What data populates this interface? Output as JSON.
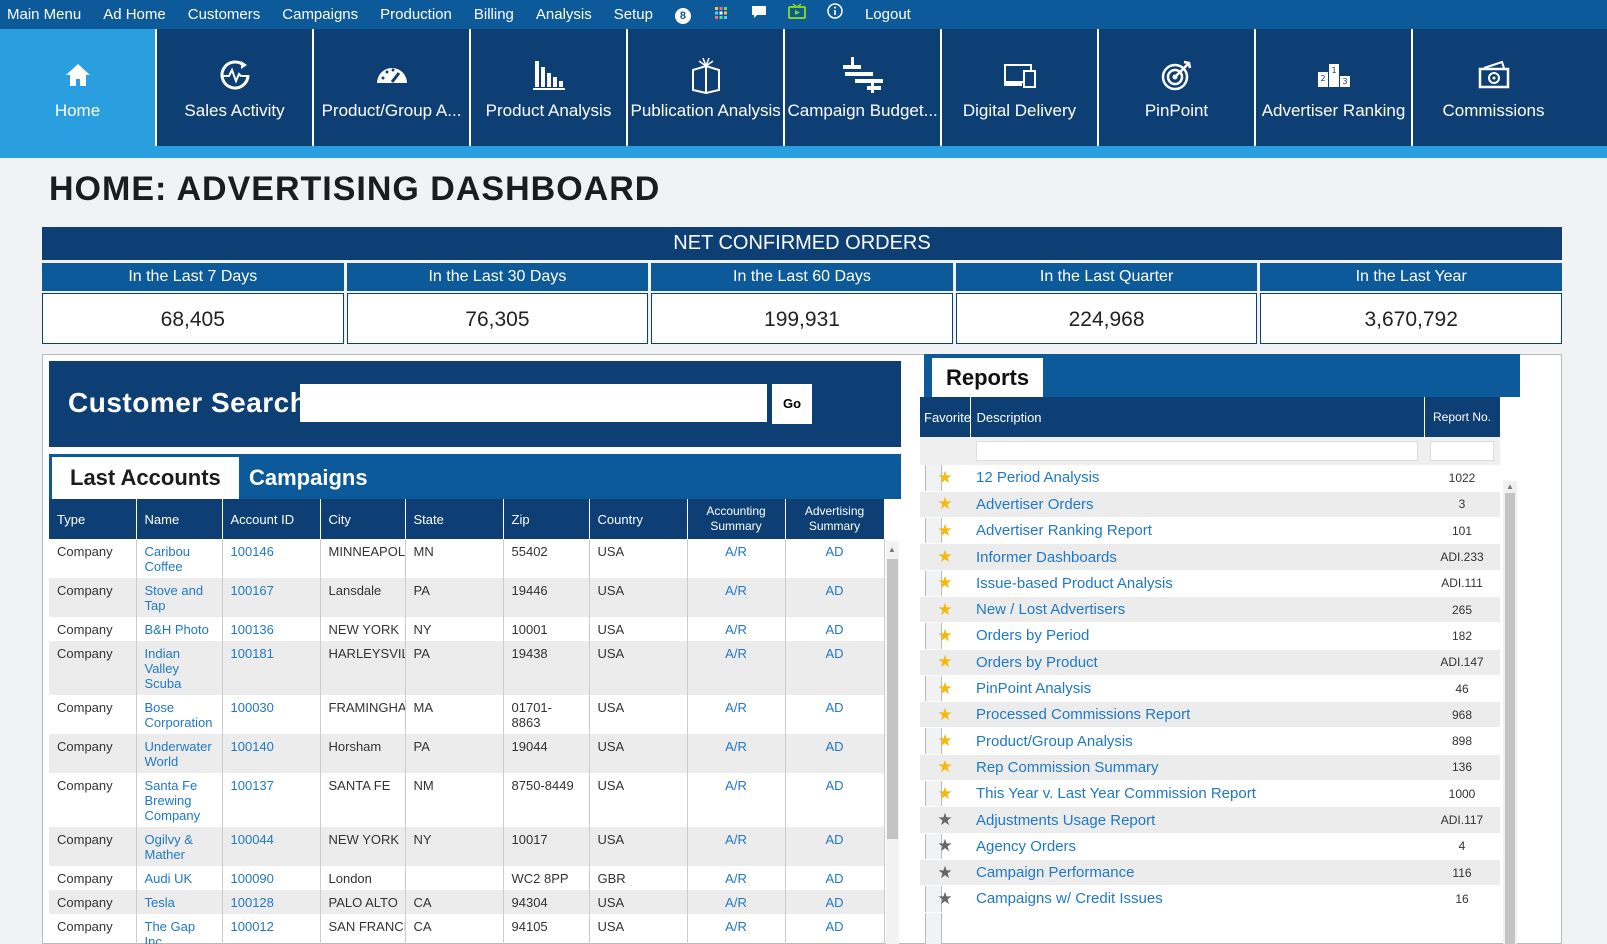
{
  "topmenu": {
    "items": [
      "Main Menu",
      "Ad Home",
      "Customers",
      "Campaigns",
      "Production",
      "Billing",
      "Analysis",
      "Setup"
    ],
    "badge": "8",
    "logout": "Logout"
  },
  "tiles": [
    {
      "label": "Home",
      "icon": "home-icon"
    },
    {
      "label": "Sales Activity",
      "icon": "sales-activity-icon"
    },
    {
      "label": "Product/Group A...",
      "icon": "gauge-icon"
    },
    {
      "label": "Product Analysis",
      "icon": "bar-chart-icon"
    },
    {
      "label": "Publication Analysis",
      "icon": "publication-icon"
    },
    {
      "label": "Campaign Budget...",
      "icon": "campaign-budget-icon"
    },
    {
      "label": "Digital Delivery",
      "icon": "devices-icon"
    },
    {
      "label": "PinPoint",
      "icon": "target-icon"
    },
    {
      "label": "Advertiser Ranking",
      "icon": "podium-icon"
    },
    {
      "label": "Commissions",
      "icon": "money-icon"
    }
  ],
  "page_title": "HOME: ADVERTISING DASHBOARD",
  "orders": {
    "title": "NET CONFIRMED ORDERS",
    "periods": [
      {
        "label": "In the Last 7 Days",
        "value": "68,405"
      },
      {
        "label": "In the Last 30 Days",
        "value": "76,305"
      },
      {
        "label": "In the Last 60 Days",
        "value": "199,931"
      },
      {
        "label": "In the Last Quarter",
        "value": "224,968"
      },
      {
        "label": "In the Last Year",
        "value": "3,670,792"
      }
    ]
  },
  "customer_search": {
    "label": "Customer Search",
    "value": "",
    "go": "Go"
  },
  "left_tabs": {
    "active": "Last Accounts",
    "other": "Campaigns"
  },
  "accounts": {
    "columns": [
      "Type",
      "Name",
      "Account ID",
      "City",
      "State",
      "Zip",
      "Country",
      "Accounting Summary",
      "Advertising Summary"
    ],
    "rows": [
      [
        "Company",
        "Caribou Coffee",
        "100146",
        "MINNEAPOLIS",
        "MN",
        "55402",
        "USA",
        "A/R",
        "AD"
      ],
      [
        "Company",
        "Stove and Tap",
        "100167",
        "Lansdale",
        "PA",
        "19446",
        "USA",
        "A/R",
        "AD"
      ],
      [
        "Company",
        "B&H Photo",
        "100136",
        "NEW YORK",
        "NY",
        "10001",
        "USA",
        "A/R",
        "AD"
      ],
      [
        "Company",
        "Indian Valley Scuba",
        "100181",
        "HARLEYSVILLE",
        "PA",
        "19438",
        "USA",
        "A/R",
        "AD"
      ],
      [
        "Company",
        "Bose Corporation",
        "100030",
        "FRAMINGHAM",
        "MA",
        "01701-8863",
        "USA",
        "A/R",
        "AD"
      ],
      [
        "Company",
        "Underwater World",
        "100140",
        "Horsham",
        "PA",
        "19044",
        "USA",
        "A/R",
        "AD"
      ],
      [
        "Company",
        "Santa Fe Brewing Company",
        "100137",
        "SANTA FE",
        "NM",
        "8750-8449",
        "USA",
        "A/R",
        "AD"
      ],
      [
        "Company",
        "Ogilvy & Mather",
        "100044",
        "NEW YORK",
        "NY",
        "10017",
        "USA",
        "A/R",
        "AD"
      ],
      [
        "Company",
        "Audi UK",
        "100090",
        "London",
        "",
        "WC2 8PP",
        "GBR",
        "A/R",
        "AD"
      ],
      [
        "Company",
        "Tesla",
        "100128",
        "PALO ALTO",
        "CA",
        "94304",
        "USA",
        "A/R",
        "AD"
      ],
      [
        "Company",
        "The Gap Inc.",
        "100012",
        "SAN FRANCISCO",
        "CA",
        "94105",
        "USA",
        "A/R",
        "AD"
      ]
    ]
  },
  "reports": {
    "tab": "Reports",
    "columns": [
      "Favorite",
      "Description",
      "Report No."
    ],
    "rows": [
      {
        "fav": true,
        "desc": "12 Period Analysis",
        "no": "1022"
      },
      {
        "fav": true,
        "desc": "Advertiser Orders",
        "no": "3"
      },
      {
        "fav": true,
        "desc": "Advertiser Ranking Report",
        "no": "101"
      },
      {
        "fav": true,
        "desc": "Informer Dashboards",
        "no": "ADI.233"
      },
      {
        "fav": true,
        "desc": "Issue-based Product Analysis",
        "no": "ADI.111"
      },
      {
        "fav": true,
        "desc": "New / Lost Advertisers",
        "no": "265"
      },
      {
        "fav": true,
        "desc": "Orders by Period",
        "no": "182"
      },
      {
        "fav": true,
        "desc": "Orders by Product",
        "no": "ADI.147"
      },
      {
        "fav": true,
        "desc": "PinPoint Analysis",
        "no": "46"
      },
      {
        "fav": true,
        "desc": "Processed Commissions Report",
        "no": "968"
      },
      {
        "fav": true,
        "desc": "Product/Group Analysis",
        "no": "898"
      },
      {
        "fav": true,
        "desc": "Rep Commission Summary",
        "no": "136"
      },
      {
        "fav": true,
        "desc": "This Year v. Last Year Commission Report",
        "no": "1000"
      },
      {
        "fav": false,
        "desc": "Adjustments Usage Report",
        "no": "ADI.117"
      },
      {
        "fav": false,
        "desc": "Agency Orders",
        "no": "4"
      },
      {
        "fav": false,
        "desc": "Campaign Performance",
        "no": "116"
      },
      {
        "fav": false,
        "desc": "Campaigns w/ Credit Issues",
        "no": "16"
      }
    ]
  },
  "colors": {
    "navy": "#0d3f75",
    "blue": "#0d5a9a",
    "accent": "#2a9fe0",
    "link": "#1f78c5",
    "star": "#f3b90e"
  }
}
